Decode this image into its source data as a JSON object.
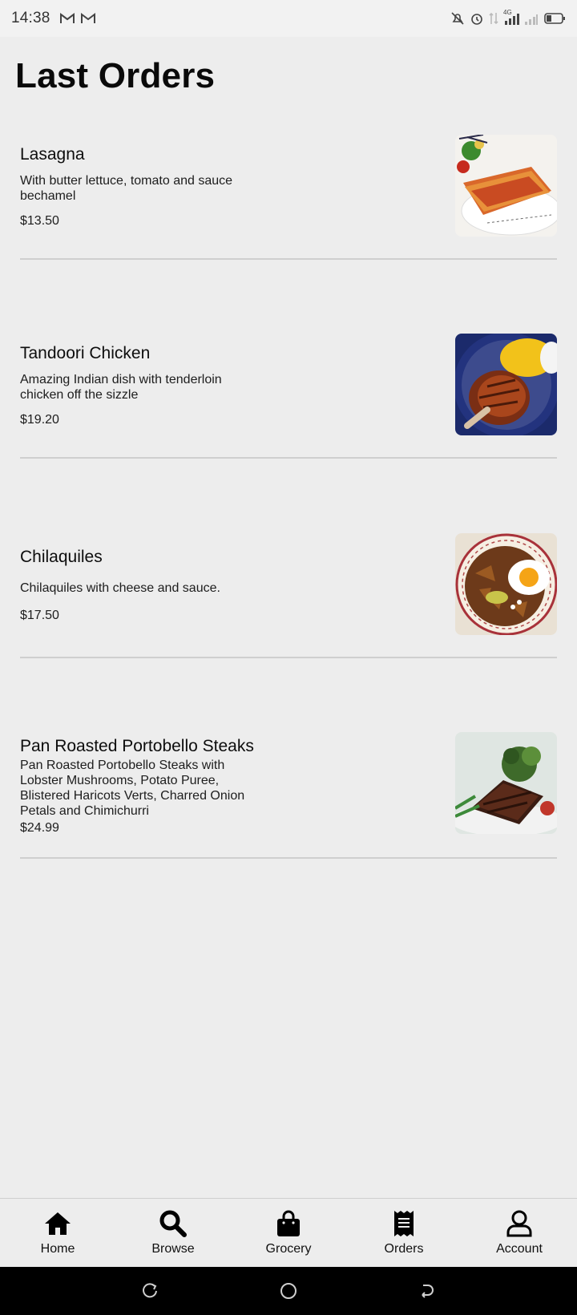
{
  "status_bar": {
    "time": "14:38",
    "notification_icons": [
      "gmail-icon",
      "gmail-icon"
    ],
    "system_icons": [
      "mute-icon",
      "alarm-icon",
      "data-icon",
      "signal-4g-icon",
      "signal-icon",
      "battery-icon"
    ],
    "network_label": "4G"
  },
  "page": {
    "title": "Last Orders"
  },
  "orders": [
    {
      "name": "Lasagna",
      "description": "With butter lettuce, tomato and sauce bechamel",
      "price": "$13.50",
      "image": "lasagna-photo"
    },
    {
      "name": "Tandoori Chicken",
      "description": "Amazing Indian dish with tenderloin chicken off the sizzle",
      "price": "$19.20",
      "image": "tandoori-chicken-photo"
    },
    {
      "name": "Chilaquiles",
      "description": "Chilaquiles with cheese and sauce.",
      "price": "$17.50",
      "image": "chilaquiles-photo"
    },
    {
      "name": "Pan Roasted Portobello Steaks",
      "description": "Pan Roasted Portobello Steaks with Lobster Mushrooms, Potato Puree, Blistered Haricots Verts, Charred Onion Petals and Chimichurri",
      "price": "$24.99",
      "image": "portobello-steak-photo"
    }
  ],
  "bottom_nav": {
    "items": [
      {
        "label": "Home",
        "icon": "home-icon"
      },
      {
        "label": "Browse",
        "icon": "search-icon"
      },
      {
        "label": "Grocery",
        "icon": "shopping-bag-icon"
      },
      {
        "label": "Orders",
        "icon": "receipt-icon"
      },
      {
        "label": "Account",
        "icon": "user-icon"
      }
    ]
  },
  "system_nav": {
    "buttons": [
      "recents-button",
      "home-button",
      "back-button"
    ]
  },
  "colors": {
    "background": "#ededed",
    "status_bar": "#f2f2f2",
    "divider": "#cfcfcf",
    "text": "#111111",
    "system_nav": "#000000"
  }
}
